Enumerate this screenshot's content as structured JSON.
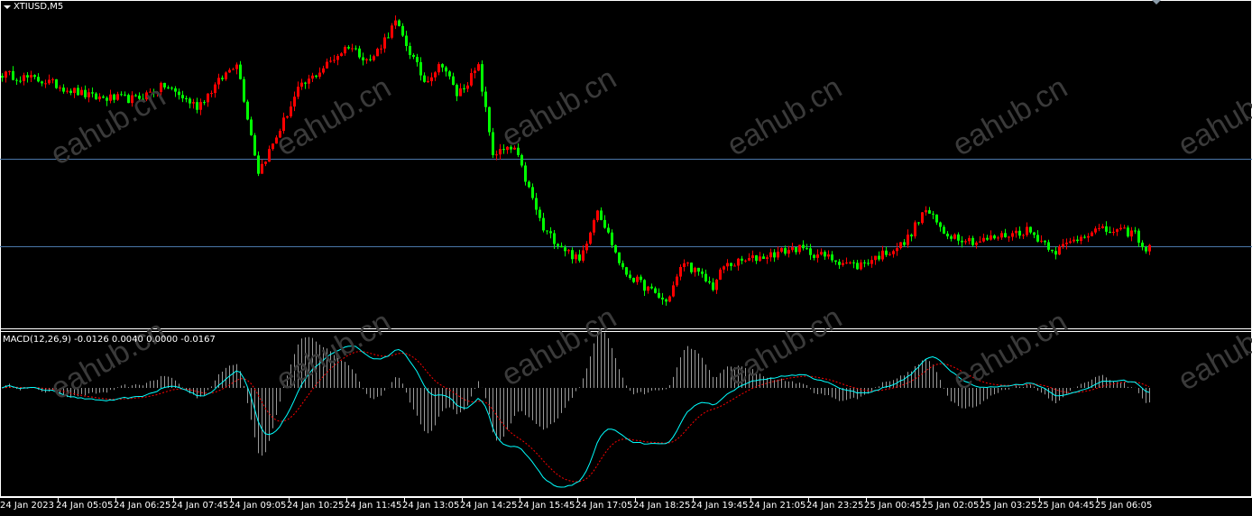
{
  "header": {
    "symbol_label": "XTIUSD,M5"
  },
  "indicator": {
    "label": "MACD(12,26,9) -0.0126 0.0040 0.0000 -0.0167"
  },
  "watermark": "eahub.cn",
  "colors": {
    "bull": "#ff0000",
    "bear": "#00ff00",
    "hline": "#4a76a8",
    "macd": "#00ffff",
    "signal": "#ff0000",
    "histogram": "#9a9a9a"
  },
  "chart_data": {
    "type": "candlestick",
    "timeframe": "M5",
    "time_labels": [
      "24 Jan 2023",
      "24 Jan 05:05",
      "24 Jan 06:25",
      "24 Jan 07:45",
      "24 Jan 09:05",
      "24 Jan 10:25",
      "24 Jan 11:45",
      "24 Jan 13:05",
      "24 Jan 14:25",
      "24 Jan 15:45",
      "24 Jan 17:05",
      "24 Jan 18:25",
      "24 Jan 19:45",
      "24 Jan 21:05",
      "24 Jan 23:25",
      "25 Jan 00:45",
      "25 Jan 02:05",
      "25 Jan 03:25",
      "25 Jan 04:45",
      "25 Jan 06:05"
    ],
    "price_anchors": [
      [
        0,
        81.69
      ],
      [
        12,
        81.65
      ],
      [
        25,
        81.56
      ],
      [
        37,
        81.55
      ],
      [
        45,
        81.625
      ],
      [
        54,
        81.51
      ],
      [
        65,
        81.76
      ],
      [
        71,
        81.15
      ],
      [
        75,
        81.3
      ],
      [
        82,
        81.6
      ],
      [
        96,
        81.85
      ],
      [
        102,
        81.76
      ],
      [
        109,
        81.975
      ],
      [
        117,
        81.65
      ],
      [
        122,
        81.75
      ],
      [
        126,
        81.575
      ],
      [
        132,
        81.725
      ],
      [
        136,
        81.25
      ],
      [
        142,
        81.275
      ],
      [
        150,
        80.825
      ],
      [
        160,
        80.65
      ],
      [
        165,
        80.95
      ],
      [
        172,
        80.6
      ],
      [
        184,
        80.425
      ],
      [
        189,
        80.65
      ],
      [
        197,
        80.51
      ],
      [
        200,
        80.625
      ],
      [
        220,
        80.725
      ],
      [
        237,
        80.625
      ],
      [
        250,
        80.75
      ],
      [
        256,
        80.94
      ],
      [
        261,
        80.81
      ],
      [
        270,
        80.76
      ],
      [
        284,
        80.825
      ],
      [
        292,
        80.71
      ],
      [
        302,
        80.825
      ],
      [
        314,
        80.81
      ],
      [
        316,
        80.71
      ],
      [
        318,
        80.75
      ]
    ],
    "horizontal_lines": [
      81.22,
      80.735
    ],
    "macd_params": [
      12,
      26,
      9
    ],
    "macd_values": {
      "main": -0.0126,
      "signal": 0.004,
      "value3": 0.0,
      "value4": -0.0167
    }
  }
}
